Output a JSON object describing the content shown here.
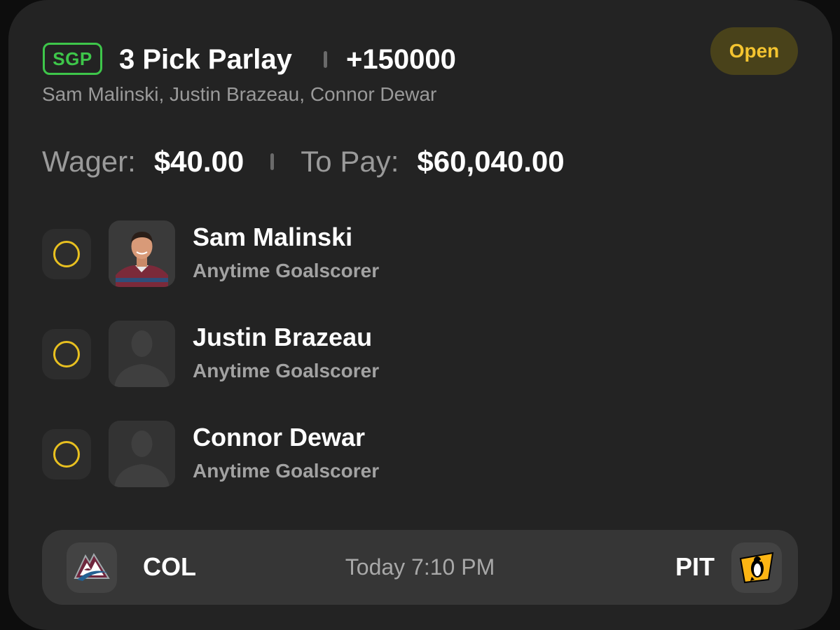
{
  "bet": {
    "badge": "SGP",
    "title": "3 Pick Parlay",
    "odds": "+150000",
    "status": "Open",
    "subtitle": "Sam Malinski, Justin Brazeau, Connor Dewar",
    "wager_label": "Wager:",
    "wager_value": "$40.00",
    "topay_label": "To Pay:",
    "topay_value": "$60,040.00"
  },
  "picks": [
    {
      "name": "Sam Malinski",
      "market": "Anytime Goalscorer",
      "avatar": "player-photo"
    },
    {
      "name": "Justin Brazeau",
      "market": "Anytime Goalscorer",
      "avatar": "silhouette-placeholder"
    },
    {
      "name": "Connor Dewar",
      "market": "Anytime Goalscorer",
      "avatar": "silhouette-placeholder"
    }
  ],
  "game": {
    "away_team": "COL",
    "home_team": "PIT",
    "time": "Today 7:10 PM",
    "away_logo": "avalanche-logo",
    "home_logo": "penguins-logo"
  },
  "colors": {
    "card_bg": "#232323",
    "sgp_green": "#3ec64a",
    "status_yellow": "#f4c430",
    "status_bg": "#49421a",
    "pending_ring": "#e8c020"
  }
}
